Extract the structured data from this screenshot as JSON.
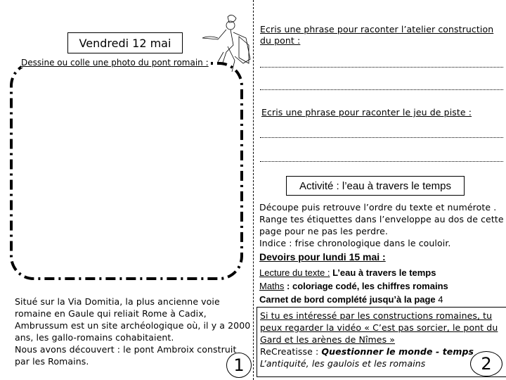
{
  "left_page": {
    "date": "Vendredi 12 mai",
    "photo_prompt": "Dessine ou colle une photo du pont romain :",
    "description": [
      "Situé sur la Via Domitia, la plus ancienne voie",
      "romaine en Gaule qui reliait Rome à Cadix,",
      "Ambrussum est un site archéologique où, il y a 2000",
      "ans, les gallo-romains cohabitaient.",
      "Nous avons découvert : le pont Ambroix construit",
      "par les Romains."
    ],
    "page_number": "1"
  },
  "right_page": {
    "prompt_atelier_line1": "Ecris une phrase pour raconter l’atelier construction",
    "prompt_atelier_line2": "du pont :",
    "prompt_piste": "Ecris une phrase pour raconter le jeu de piste :",
    "activity_title": "Activité : l’eau à travers le temps",
    "instructions": [
      "Découpe  puis retrouve l’ordre du texte et numérote .",
      "Range tes étiquettes dans l’enveloppe au dos de cette",
      "page pour ne pas les perdre.",
      "Indice : frise chronologique dans le couloir."
    ],
    "homework": {
      "title": "Devoirs pour lundi 15 mai :",
      "reading_label": "Lecture du texte :",
      "reading_value": " L’eau à travers le temps",
      "maths_label": "Maths",
      "maths_value": " : coloriage codé, les chiffres romains",
      "notebook": "Carnet de bord complété jusqu’à la page ",
      "notebook_page": "4"
    },
    "info": {
      "line1": "Si tu es intéressé par les constructions romaines, tu",
      "line2": "peux regarder la vidéo « C’est pas sorcier, le pont du",
      "line3": "Gard et les arènes de Nîmes »",
      "line4_prefix": "ReCreatisse : ",
      "line4_italic": "Questionner le monde - temps",
      "line5": "L’antiquité, les gaulois et les romains"
    },
    "page_number": "2"
  }
}
